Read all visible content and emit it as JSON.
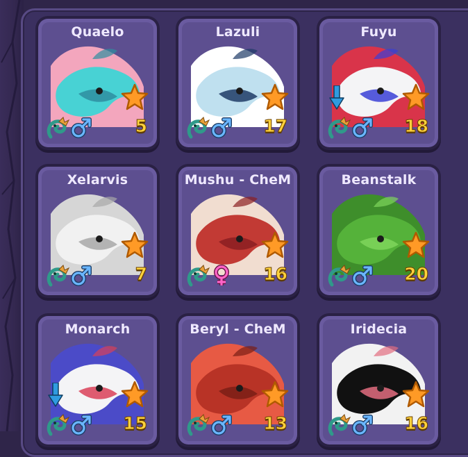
{
  "pets": [
    {
      "name": "Quaelo",
      "level": "5",
      "gender": "male",
      "gender_icon": "male-icon",
      "has_arrow": false,
      "colors": [
        "#48d2d4",
        "#f3a6bd",
        "#2f8ea0"
      ]
    },
    {
      "name": "Lazuli",
      "level": "17",
      "gender": "male",
      "gender_icon": "male-icon",
      "has_arrow": false,
      "colors": [
        "#bfe0ef",
        "#ffffff",
        "#1e3b66"
      ]
    },
    {
      "name": "Fuyu",
      "level": "18",
      "gender": "male",
      "gender_icon": "male-icon",
      "has_arrow": true,
      "colors": [
        "#f4f4f6",
        "#d9344a",
        "#3a3fd6"
      ]
    },
    {
      "name": "Xelarvis",
      "level": "7",
      "gender": "male",
      "gender_icon": "male-icon",
      "has_arrow": false,
      "colors": [
        "#f1f1f1",
        "#d6d6d6",
        "#a8a8a8"
      ]
    },
    {
      "name": "Mushu - CheM",
      "level": "16",
      "gender": "female",
      "gender_icon": "female-icon",
      "has_arrow": false,
      "colors": [
        "#c23a34",
        "#f1ddd0",
        "#8b1f22"
      ]
    },
    {
      "name": "Beanstalk",
      "level": "20",
      "gender": "male",
      "gender_icon": "male-icon",
      "has_arrow": false,
      "colors": [
        "#55b23a",
        "#3e8e2b",
        "#7fd55c"
      ]
    },
    {
      "name": "Monarch",
      "level": "15",
      "gender": "male",
      "gender_icon": "male-icon",
      "has_arrow": true,
      "colors": [
        "#f4f4f6",
        "#4b4bc8",
        "#d94058"
      ]
    },
    {
      "name": "Beryl - CheM",
      "level": "13",
      "gender": "male",
      "gender_icon": "male-icon",
      "has_arrow": false,
      "colors": [
        "#b83326",
        "#e75a44",
        "#7a1e16"
      ]
    },
    {
      "name": "Iridecia",
      "level": "16",
      "gender": "male",
      "gender_icon": "male-icon",
      "has_arrow": false,
      "colors": [
        "#111111",
        "#f2f2f2",
        "#e36d80"
      ]
    }
  ],
  "colors": {
    "star": "#ff9a26",
    "level": "#ffd23c",
    "male": "#6ab6ff",
    "female": "#ff64c8",
    "arrow": "#2f9be0"
  }
}
